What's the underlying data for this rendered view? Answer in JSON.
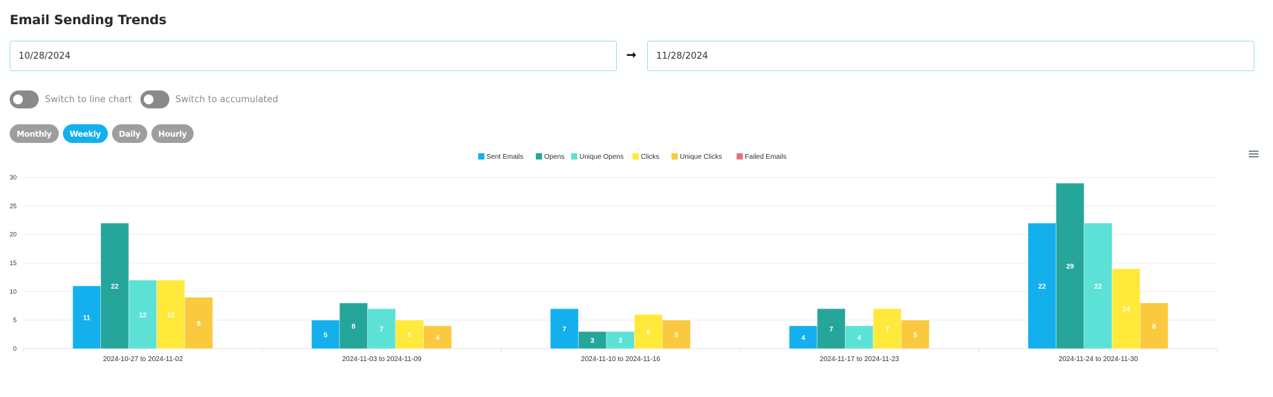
{
  "header": {
    "title": "Email Sending Trends"
  },
  "date_range": {
    "start_value": "10/28/2024",
    "separator_icon": "arrow-right-icon",
    "end_value": "11/28/2024"
  },
  "toggles": [
    {
      "label": "Switch to line chart",
      "checked": false
    },
    {
      "label": "Switch to accumulated",
      "checked": false
    }
  ],
  "periods": [
    {
      "label": "Monthly",
      "active": false
    },
    {
      "label": "Weekly",
      "active": true
    },
    {
      "label": "Daily",
      "active": false
    },
    {
      "label": "Hourly",
      "active": false
    }
  ],
  "menu": {
    "icon": "hamburger-menu-icon"
  },
  "chart_data": {
    "type": "bar",
    "title": "",
    "xlabel": "",
    "ylabel": "",
    "ylim": [
      0,
      30
    ],
    "yticks": [
      0,
      5,
      10,
      15,
      20,
      25,
      30
    ],
    "grid": true,
    "legend_position": "top-center",
    "categories": [
      "2024-10-27 to 2024-11-02",
      "2024-11-03 to 2024-11-09",
      "2024-11-10 to 2024-11-16",
      "2024-11-17 to 2024-11-23",
      "2024-11-24 to 2024-11-30"
    ],
    "series": [
      {
        "name": "Sent Emails",
        "color": "#13b0ed",
        "values": [
          11,
          5,
          7,
          4,
          22
        ]
      },
      {
        "name": "Opens",
        "color": "#26a69a",
        "values": [
          22,
          8,
          3,
          7,
          29
        ]
      },
      {
        "name": "Unique Opens",
        "color": "#5ce1d6",
        "values": [
          12,
          7,
          3,
          4,
          22
        ]
      },
      {
        "name": "Clicks",
        "color": "#ffe93b",
        "values": [
          12,
          5,
          6,
          7,
          14
        ]
      },
      {
        "name": "Unique Clicks",
        "color": "#fac93e",
        "values": [
          9,
          4,
          5,
          5,
          8
        ]
      },
      {
        "name": "Failed Emails",
        "color": "#e57373",
        "values": [
          0,
          0,
          0,
          0,
          0
        ]
      }
    ]
  }
}
